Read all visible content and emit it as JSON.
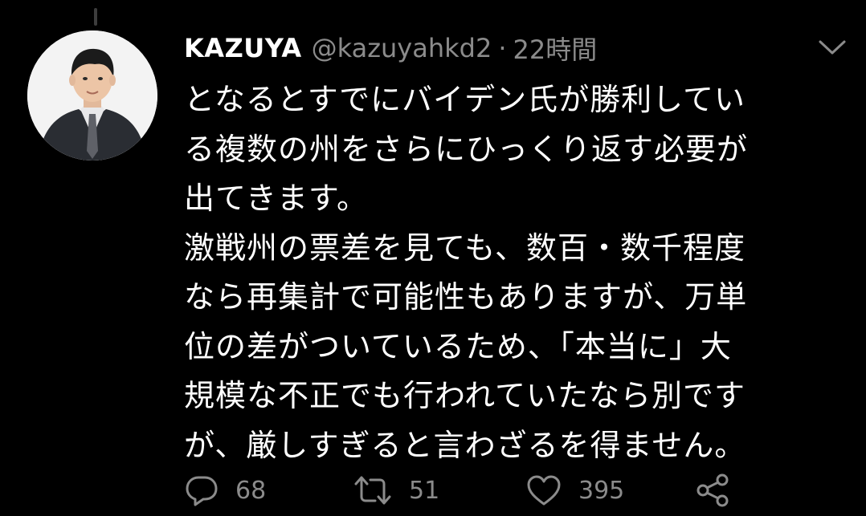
{
  "tweet": {
    "display_name": "KAZUYA",
    "handle": "@kazuyahkd2",
    "separator": "·",
    "timestamp": "22時間",
    "text_lines": [
      "となるとすでにバイデン氏が勝利してい",
      "る複数の州をさらにひっくり返す必要が",
      "出てきます。",
      "激戦州の票差を見ても、数百・数千程度",
      "なら再集計で可能性もありますが、万単",
      "位の差がついているため、「本当に」大",
      "規模な不正でも行われていたなら別です",
      "が、厳しすぎると言わざるを得ません。"
    ],
    "reply_count": "68",
    "retweet_count": "51",
    "like_count": "395"
  },
  "icons": {
    "reply": "reply-icon",
    "retweet": "retweet-icon",
    "like": "heart-icon",
    "share": "share-icon",
    "menu": "chevron-down-icon"
  },
  "colors": {
    "background": "#000000",
    "primary_text": "#ffffff",
    "secondary_text": "#8b8b8b"
  }
}
